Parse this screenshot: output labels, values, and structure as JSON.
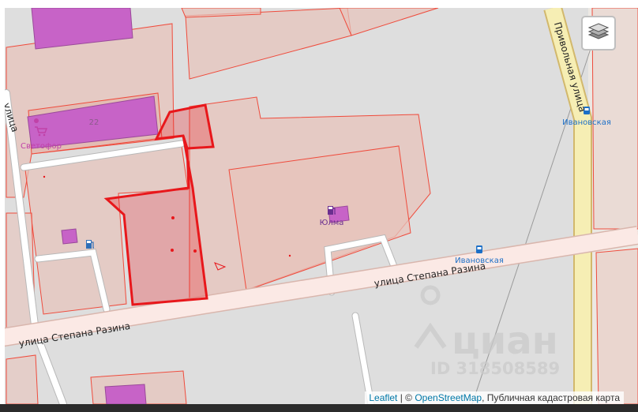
{
  "map": {
    "streets": {
      "razina_main": "улица Степана Разина",
      "razina_lower": "улица Степана Разина",
      "privolnaya": "Привольная улица",
      "left_street": "улица"
    },
    "pois": {
      "svetofor": "Светофор",
      "yulma": "Юлма",
      "ivanovskaya_top": "Ивановская",
      "ivanovskaya_bottom": "Ивановская",
      "house_number": "22"
    },
    "watermark": {
      "brand": "циан",
      "id": "ID 318508589"
    },
    "colors": {
      "selected_parcel": "#e8171b",
      "parcel_border": "#ef4b3c",
      "road": "#fbe9e5",
      "primary_road": "#f6eeb4",
      "building": "#c763c7"
    }
  },
  "controls": {
    "layers_icon": "layers-icon"
  },
  "attribution": {
    "leaflet": "Leaflet",
    "separator": " | © ",
    "osm": "OpenStreetMap",
    "cadastre": ", Публичная кадастровая карта"
  }
}
